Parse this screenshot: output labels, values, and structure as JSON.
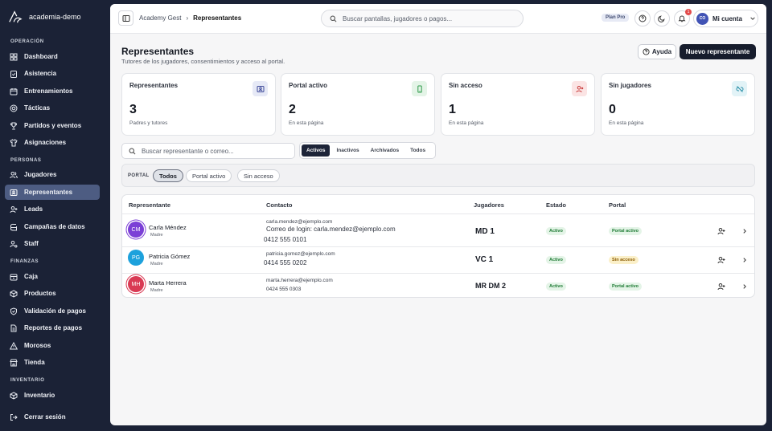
{
  "brand": {
    "name": "academia-demo"
  },
  "sidebar": {
    "sections": [
      {
        "title": "OPERACIÓN",
        "items": [
          {
            "label": "Dashboard",
            "icon": "dashboard-icon"
          },
          {
            "label": "Asistencia",
            "icon": "clipboard-check-icon"
          },
          {
            "label": "Entrenamientos",
            "icon": "calendar-icon"
          },
          {
            "label": "Tácticas",
            "icon": "target-icon"
          },
          {
            "label": "Partidos y eventos",
            "icon": "trophy-icon"
          },
          {
            "label": "Asignaciones",
            "icon": "shirt-icon"
          }
        ]
      },
      {
        "title": "PERSONAS",
        "items": [
          {
            "label": "Jugadores",
            "icon": "users-icon"
          },
          {
            "label": "Representantes",
            "icon": "id-card-icon",
            "active": true
          },
          {
            "label": "Leads",
            "icon": "user-plus-icon"
          },
          {
            "label": "Campañas de datos",
            "icon": "database-icon"
          },
          {
            "label": "Staff",
            "icon": "user-gear-icon"
          }
        ]
      },
      {
        "title": "FINANZAS",
        "items": [
          {
            "label": "Caja",
            "icon": "cash-box-icon"
          },
          {
            "label": "Productos",
            "icon": "box-icon"
          },
          {
            "label": "Validación de pagos",
            "icon": "shield-check-icon"
          },
          {
            "label": "Reportes de pagos",
            "icon": "file-report-icon"
          },
          {
            "label": "Morosos",
            "icon": "alert-triangle-icon"
          },
          {
            "label": "Tienda",
            "icon": "store-icon"
          }
        ]
      },
      {
        "title": "INVENTARIO",
        "items": [
          {
            "label": "Inventario",
            "icon": "package-icon"
          }
        ]
      }
    ],
    "logout": "Cerrar sesión"
  },
  "topbar": {
    "breadcrumb": [
      "Academy Gest",
      "Representantes"
    ],
    "search_placeholder": "Buscar pantallas, jugadores o pagos...",
    "plan": "Plan Pro",
    "notifications": "1",
    "avatar_initials": "CO",
    "account": "Mi cuenta"
  },
  "page": {
    "title": "Representantes",
    "subtitle": "Tutores de los jugadores, consentimientos y acceso al portal.",
    "help": "Ayuda",
    "new": "Nuevo representante"
  },
  "stats": [
    {
      "title": "Representantes",
      "value": "3",
      "sub": "Padres y tutores",
      "icon": "id-card-icon",
      "color": "#3f4a9a",
      "bg": "#e6e9f6"
    },
    {
      "title": "Portal activo",
      "value": "2",
      "sub": "En esta página",
      "icon": "phone-icon",
      "color": "#2e9a4a",
      "bg": "#e4f4e7"
    },
    {
      "title": "Sin acceso",
      "value": "1",
      "sub": "En esta página",
      "icon": "user-x-icon",
      "color": "#c93b3b",
      "bg": "#fbe4e4"
    },
    {
      "title": "Sin jugadores",
      "value": "0",
      "sub": "En esta página",
      "icon": "link-off-icon",
      "color": "#2a8fa8",
      "bg": "#e2f3f7"
    }
  ],
  "filters": {
    "search_placeholder": "Buscar representante o correo...",
    "status_tabs": [
      {
        "label": "Activos",
        "active": true
      },
      {
        "label": "Inactivos"
      },
      {
        "label": "Archivados"
      },
      {
        "label": "Todos"
      }
    ],
    "portal_label": "PORTAL",
    "portal_chips": [
      {
        "label": "Todos",
        "active": true
      },
      {
        "label": "Portal activo"
      },
      {
        "label": "Sin acceso"
      }
    ]
  },
  "table": {
    "headers": [
      "Representante",
      "Contacto",
      "Jugadores",
      "Estado",
      "Portal"
    ],
    "rows": [
      {
        "initials": "CM",
        "avatar_color": "#7b3fd6",
        "name": "Carla Méndez",
        "relation": "Madre",
        "email": "carla.mendez@ejemplo.com",
        "login_note": "Correo de login: carla.mendez@ejemplo.com",
        "phone": "0412 555 0101",
        "players": "MD 1",
        "status": "Activo",
        "portal": "Portal activo",
        "portal_kind": "green"
      },
      {
        "initials": "PG",
        "avatar_color": "#1da1dc",
        "name": "Patricia Gómez",
        "relation": "Madre",
        "email": "patricia.gomez@ejemplo.com",
        "phone": "0414 555 0202",
        "players": "VC 1",
        "status": "Activo",
        "portal": "Sin acceso",
        "portal_kind": "amber"
      },
      {
        "initials": "MH",
        "avatar_color": "#d93a54",
        "name": "Marta Herrera",
        "relation": "Madre",
        "email": "marta.herrera@ejemplo.com",
        "phone": "0424 555 0303",
        "players": "MR DM 2",
        "status": "Activo",
        "portal": "Portal activo",
        "portal_kind": "green"
      }
    ]
  }
}
